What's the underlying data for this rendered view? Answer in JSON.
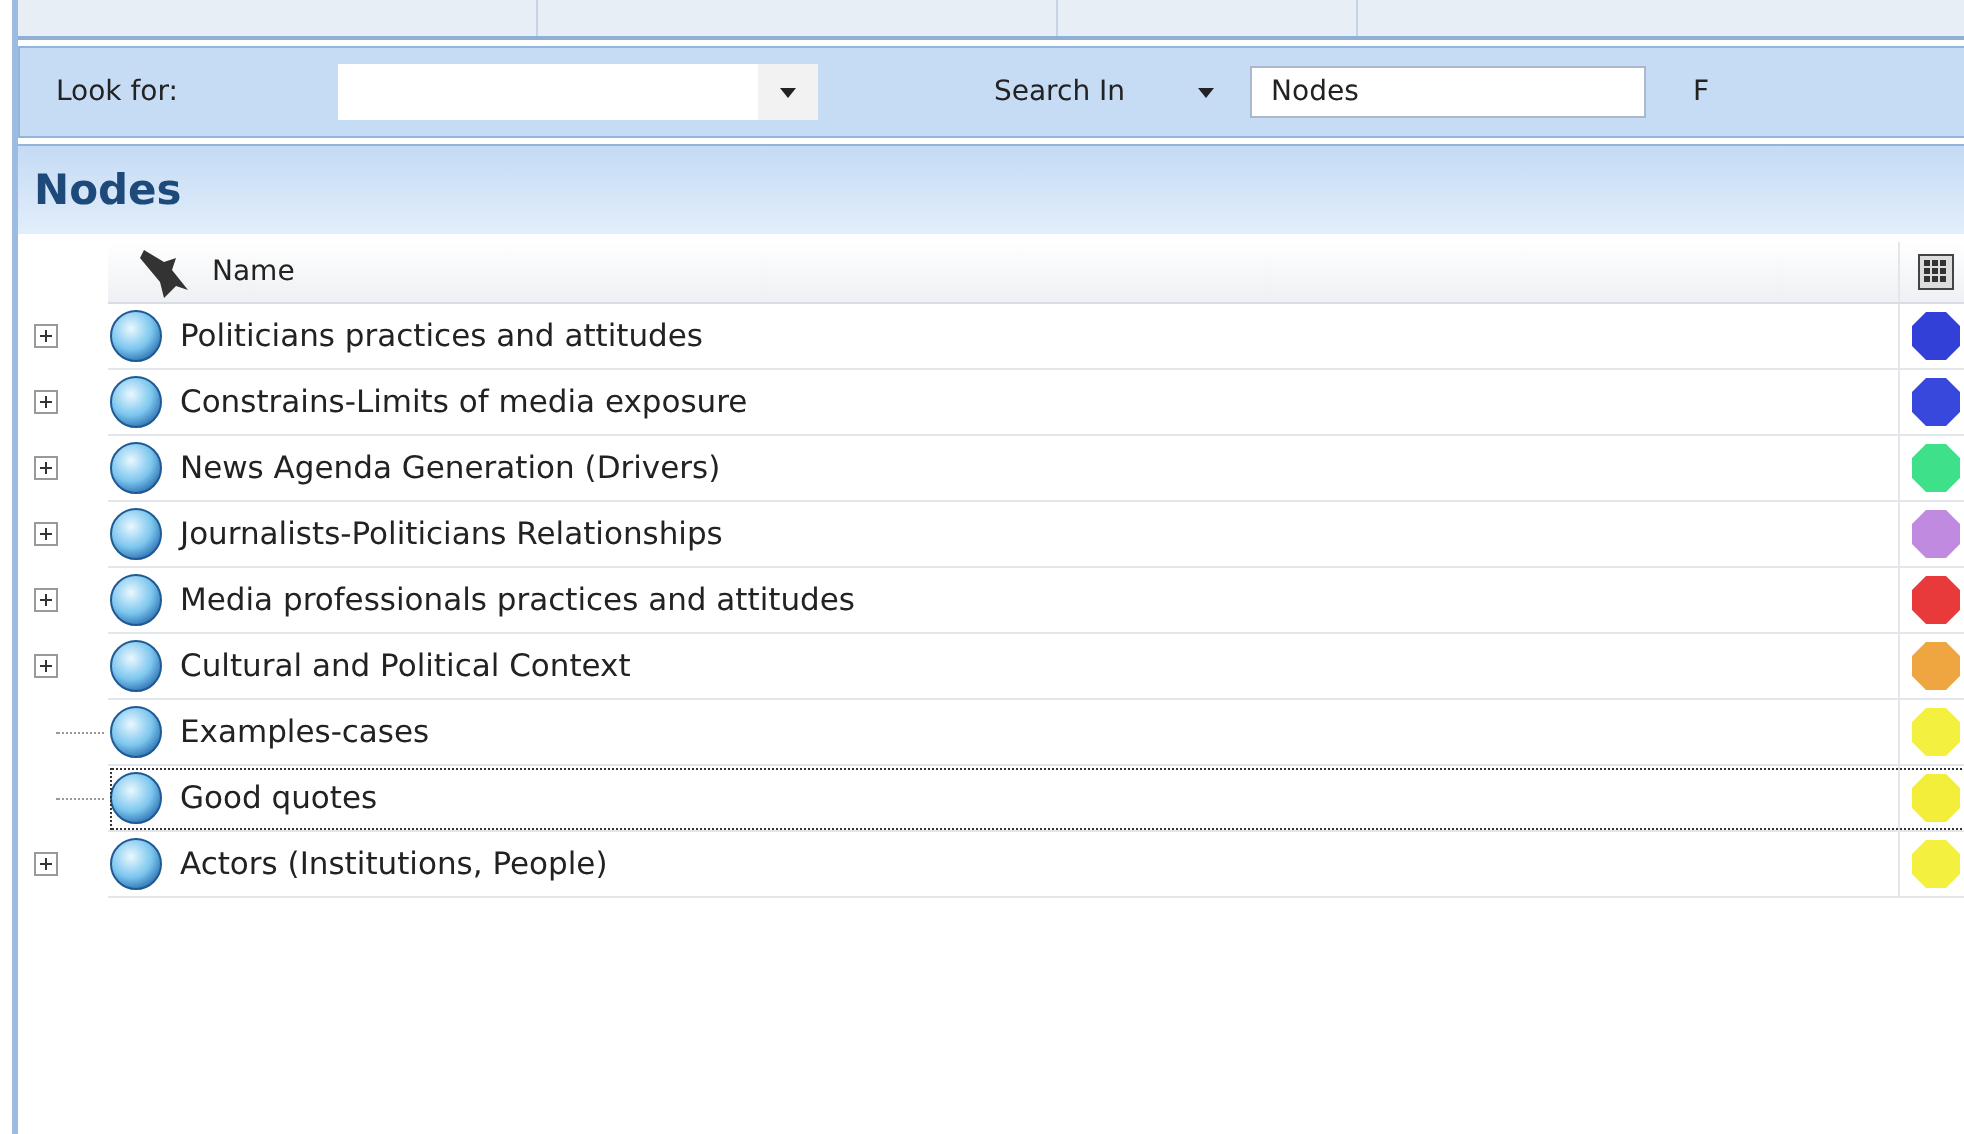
{
  "find_bar": {
    "look_for_label": "Look for:",
    "search_in_label": "Search In",
    "search_in_value": "Nodes",
    "cut_label": "F"
  },
  "panel": {
    "title": "Nodes"
  },
  "columns": [
    "Name"
  ],
  "nodes": [
    {
      "name": "Politicians practices and attitudes",
      "expandable": true,
      "focused": false,
      "color": "#3340d8"
    },
    {
      "name": "Constrains-Limits of media exposure",
      "expandable": true,
      "focused": false,
      "color": "#3848dc"
    },
    {
      "name": "News Agenda Generation (Drivers)",
      "expandable": true,
      "focused": false,
      "color": "#3ee08a"
    },
    {
      "name": "Journalists-Politicians Relationships",
      "expandable": true,
      "focused": false,
      "color": "#c08ae0"
    },
    {
      "name": "Media professionals practices and attitudes",
      "expandable": true,
      "focused": false,
      "color": "#e83a3a"
    },
    {
      "name": "Cultural and Political Context",
      "expandable": true,
      "focused": false,
      "color": "#f0a640"
    },
    {
      "name": "Examples-cases",
      "expandable": false,
      "focused": false,
      "color": "#f4f040"
    },
    {
      "name": "Good quotes",
      "expandable": false,
      "focused": true,
      "color": "#f2ee3a"
    },
    {
      "name": "Actors (Institutions, People)",
      "expandable": true,
      "focused": false,
      "color": "#f4f040"
    }
  ]
}
